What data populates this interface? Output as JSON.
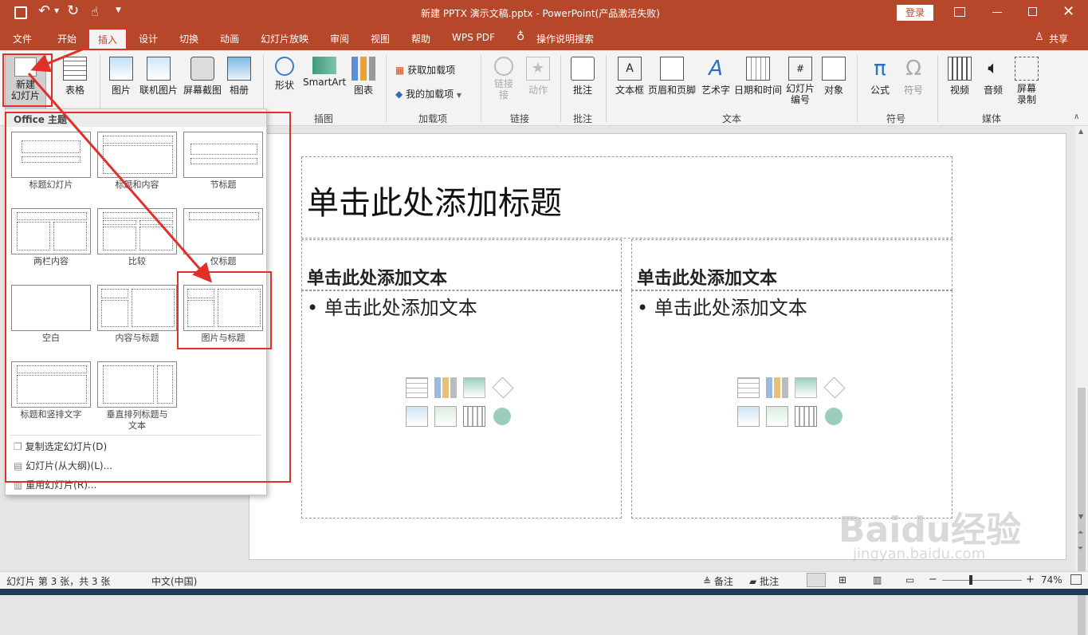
{
  "window": {
    "title": "新建 PPTX 演示文稿.pptx  -  PowerPoint(产品激活失败)",
    "login": "登录"
  },
  "tabs": [
    "文件",
    "开始",
    "插入",
    "设计",
    "切换",
    "动画",
    "幻灯片放映",
    "审阅",
    "视图",
    "帮助",
    "WPS PDF"
  ],
  "tell_me": "操作说明搜索",
  "share": "共享",
  "ribbon": {
    "new_slide": [
      "新建",
      "幻灯片"
    ],
    "table": "表格",
    "images": [
      "图片",
      "联机图片",
      "屏幕截图",
      "相册"
    ],
    "illus": [
      "形状",
      "SmartArt",
      "图表"
    ],
    "addins": [
      "获取加载项",
      "我的加载项"
    ],
    "links": [
      "链接",
      "接",
      "动作"
    ],
    "comment": "批注",
    "text": [
      "文本框",
      "页眉和页脚",
      "艺术字",
      "日期和时间",
      "幻灯片",
      "编号",
      "对象"
    ],
    "symbols": [
      "公式",
      "符号"
    ],
    "media": [
      "视频",
      "音频",
      "屏幕",
      "录制"
    ],
    "groups": [
      "插图",
      "加载项",
      "链接",
      "批注",
      "文本",
      "符号",
      "媒体"
    ]
  },
  "dropdown": {
    "header": "Office 主题",
    "layouts": [
      "标题幻灯片",
      "标题和内容",
      "节标题",
      "两栏内容",
      "比较",
      "仅标题",
      "空白",
      "内容与标题",
      "图片与标题",
      "标题和竖排文字",
      "垂直排列标题与",
      "文本"
    ],
    "menu": [
      "复制选定幻灯片(D)",
      "幻灯片(从大纲)(L)...",
      "重用幻灯片(R)..."
    ]
  },
  "slide": {
    "title": "单击此处添加标题",
    "left_head": "单击此处添加文本",
    "left_bullet": "• 单击此处添加文本",
    "right_head": "单击此处添加文本",
    "right_bullet": "• 单击此处添加文本"
  },
  "status": {
    "slide": "幻灯片 第 3 张，共 3 张",
    "lang": "中文(中国)",
    "notes": "备注",
    "comments": "批注",
    "zoom": "74%"
  },
  "watermark": {
    "brand": "Baidu经验",
    "url": "jingyan.baidu.com"
  },
  "colors": {
    "accent": "#b7472a",
    "highlight": "#e0302a"
  }
}
